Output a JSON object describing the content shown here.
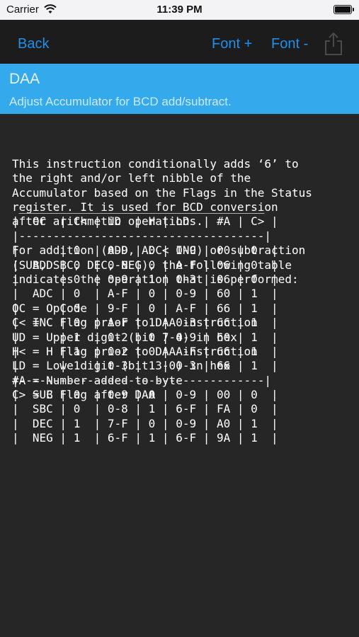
{
  "status_bar": {
    "carrier": "Carrier",
    "time": "11:39 PM"
  },
  "nav": {
    "back_label": "Back",
    "font_plus_label": "Font +",
    "font_minus_label": "Font -",
    "share_icon": "share-icon"
  },
  "header": {
    "title": "DAA",
    "subtitle": "Adjust Accumulator for BCD add/subtract."
  },
  "description_lines": [
    "This instruction conditionally adds ‘6’ to",
    "the right and/or left nibble of the",
    "Accumulator based on the Flags in the Status",
    "register. It is used for BCD conversion",
    "after arithmetic operations.",
    "",
    "For addition (ADD, ADC< INC) or subtraction",
    "(SUB, SBC, DEC, NEG), the following table",
    "indicates the operation that is performed:",
    "",
    "OC = OpCode",
    "C< = C Flag prior to DAA instruction",
    "UD = Upper digit (bit 7-4) in hex",
    "H< = H Flag prior to DAA instruction",
    "LD = Lowe digit (bit 3-0) in hex",
    "#A = Number added to byte",
    "C> = C Flag after DAA",
    "",
    ""
  ],
  "table_lines": [
    " ____________________________________",
    "|  OC  | C< | UD  | H | LD  | #A | C> |",
    "|------------------------------------|",
    "|      | 0  | 0-9 | 0 | 0-9 | 00 | 0  |",
    "|  ADD | 0  | 0-8 | 0 | A-F | 06 | 0  |",
    "|      | 0  | 0-9 | 1 | 0-3 | 06 | 0  |",
    "|  ADC | 0  | A-F | 0 | 0-9 | 60 | 1  |",
    "|      | 0  | 9-F | 0 | A-F | 66 | 1  |",
    "|  INC | 0  | A-F | 1 | 0-3 | 66 | 1  |",
    "|      | 1  | 0-2 | 0 | 0-9 | 60 | 1  |",
    "|      | 1  | 0-2 | 0 | A-F | 66 | 1  |",
    "|      | 1  | 0-3 | 1 | 0-3 | 66 | 1  |",
    "|------------------------------------|",
    "|  SUB | 0  | 0-9 | 0 | 0-9 | 00 | 0  |",
    "|  SBC | 0  | 0-8 | 1 | 6-F | FA | 0  |",
    "|  DEC | 1  | 7-F | 0 | 0-9 | A0 | 1  |",
    "|  NEG | 1  | 6-F | 1 | 6-F | 9A | 1  |"
  ]
}
